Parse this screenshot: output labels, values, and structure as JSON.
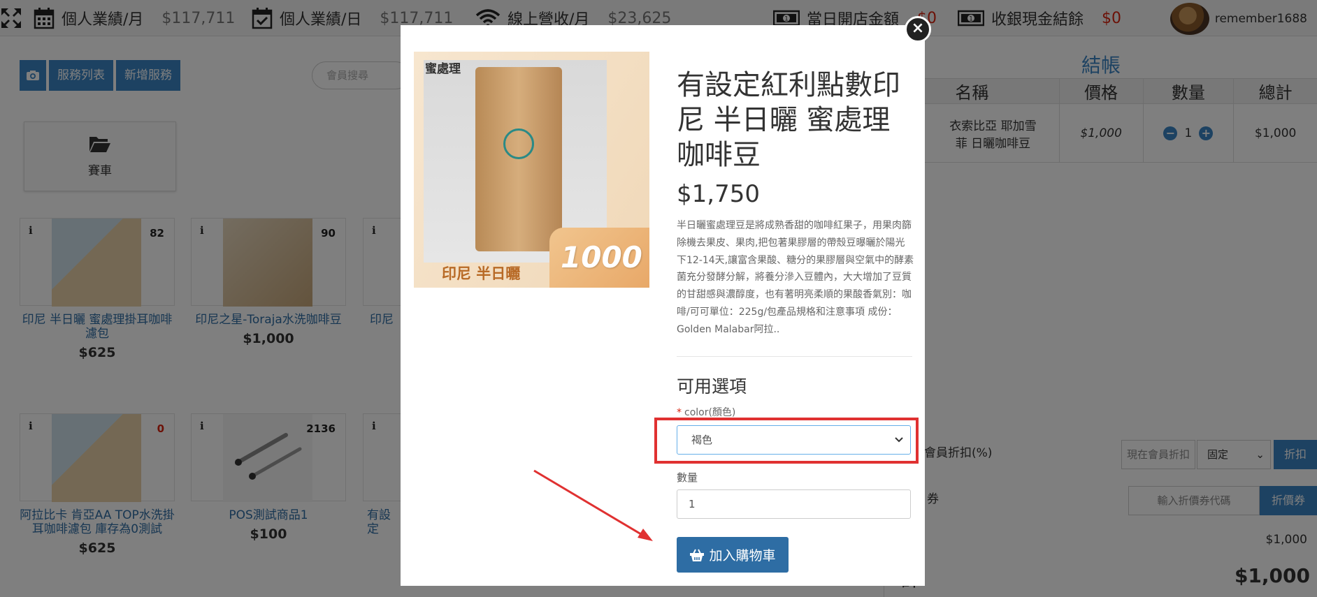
{
  "topbar": {
    "items": [
      {
        "icon": "calendar-icon",
        "label": "個人業績/月",
        "value": "$117,711"
      },
      {
        "icon": "calendar-check-icon",
        "label": "個人業績/日",
        "value": "$117,711"
      },
      {
        "icon": "wifi-icon",
        "label": "線上營收/月",
        "value": "$23,625"
      },
      {
        "icon": "money-icon",
        "label": "當日開店金額",
        "value": "$0"
      },
      {
        "icon": "money-icon",
        "label": "收銀現金結餘",
        "value": "$0"
      }
    ],
    "username": "remember1688",
    "accent": "#d9230f"
  },
  "toolbar": {
    "camera_icon": "camera-icon",
    "service_list": "服務列表",
    "add_service": "新增服務"
  },
  "search": {
    "placeholder": "會員搜尋"
  },
  "folder": {
    "icon": "folder-open-icon",
    "label": "賽車"
  },
  "products": [
    {
      "name": "印尼 半日曬 蜜處理掛耳咖啡濾包",
      "price": "$625",
      "stock": "82"
    },
    {
      "name": "印尼之星-Toraja水洗咖啡豆",
      "price": "$1,000",
      "stock": "90"
    },
    {
      "name": "印尼",
      "price": "",
      "stock": ""
    },
    {
      "name": "阿拉比卡 肯亞AA TOP水洗掛耳咖啡濾包 庫存為0測試",
      "price": "$625",
      "stock": "0"
    },
    {
      "name": "POS測試商品1",
      "price": "$100",
      "stock": "2136"
    },
    {
      "name": "有設定",
      "price": "",
      "stock": ""
    }
  ],
  "checkout": {
    "title": "結帳",
    "headers": [
      "名稱",
      "價格",
      "數量",
      "總計"
    ],
    "row": {
      "name": "衣索比亞 耶加雪菲 日曬咖啡豆",
      "price": "$1,000",
      "qty": "1",
      "total": "$1,000"
    },
    "member_discount_label": "會員折扣(%)",
    "member_discount_placeholder": "現在會員折扣",
    "discount_type": "固定",
    "discount_button": "折扣",
    "coupon_label": "券",
    "coupon_placeholder": "輸入折價券代碼",
    "coupon_button": "折價券",
    "subtotal": "$1,000",
    "total_label": "計",
    "total": "$1,000"
  },
  "modal": {
    "close_icon": "close-icon",
    "image": {
      "tag": "蜜處理",
      "bottom": "印尼 半日曬",
      "badge": "1000"
    },
    "title": "有設定紅利點數印尼 半日曬 蜜處理咖啡豆",
    "price": "$1,750",
    "description": "半日曬蜜處理豆是將成熟香甜的咖啡紅果子，用果肉篩除機去果皮、果肉,把包著果膠層的帶殼豆曝曬於陽光下12-14天,讓富含果酸、糖分的果膠層與空氣中的酵素菌充分發酵分解，將養分滲入豆體內，大大增加了豆質的甘甜感與濃醇度，也有著明亮柔順的果酸香氣別：咖啡/可可單位：225g/包產品規格和注意事項 成份：Golden Malabar阿拉..",
    "options_heading": "可用選項",
    "color_label": "color(顏色)",
    "color_value": "褐色",
    "qty_label": "數量",
    "qty_value": "1",
    "add_to_cart": "加入購物車",
    "highlight_color": "#e03131"
  }
}
